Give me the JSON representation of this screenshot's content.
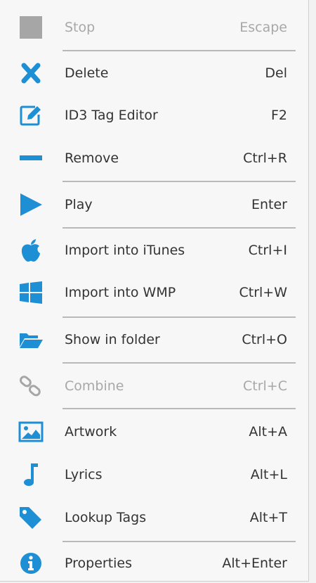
{
  "colors": {
    "accent": "#1e8fd5",
    "disabled": "#a8a8a8",
    "text": "#333333",
    "separator": "#b9b9b9"
  },
  "menu": {
    "stop": {
      "label": "Stop",
      "shortcut": "Escape",
      "icon": "stop-square-icon",
      "enabled": false
    },
    "delete": {
      "label": "Delete",
      "shortcut": "Del",
      "icon": "x-icon",
      "enabled": true
    },
    "id3": {
      "label": "ID3 Tag Editor",
      "shortcut": "F2",
      "icon": "edit-icon",
      "enabled": true
    },
    "remove": {
      "label": "Remove",
      "shortcut": "Ctrl+R",
      "icon": "minus-icon",
      "enabled": true
    },
    "play": {
      "label": "Play",
      "shortcut": "Enter",
      "icon": "play-icon",
      "enabled": true
    },
    "itunes": {
      "label": "Import into iTunes",
      "shortcut": "Ctrl+I",
      "icon": "apple-icon",
      "enabled": true
    },
    "wmp": {
      "label": "Import into WMP",
      "shortcut": "Ctrl+W",
      "icon": "windows-icon",
      "enabled": true
    },
    "folder": {
      "label": "Show in folder",
      "shortcut": "Ctrl+O",
      "icon": "folder-open-icon",
      "enabled": true
    },
    "combine": {
      "label": "Combine",
      "shortcut": "Ctrl+C",
      "icon": "link-icon",
      "enabled": false
    },
    "artwork": {
      "label": "Artwork",
      "shortcut": "Alt+A",
      "icon": "image-icon",
      "enabled": true
    },
    "lyrics": {
      "label": "Lyrics",
      "shortcut": "Alt+L",
      "icon": "music-note-icon",
      "enabled": true
    },
    "lookup": {
      "label": "Lookup Tags",
      "shortcut": "Alt+T",
      "icon": "tag-icon",
      "enabled": true
    },
    "properties": {
      "label": "Properties",
      "shortcut": "Alt+Enter",
      "icon": "info-icon",
      "enabled": true
    }
  }
}
